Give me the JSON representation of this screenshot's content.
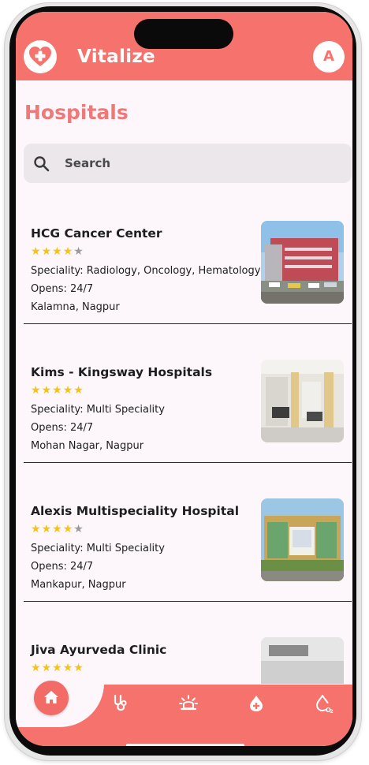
{
  "app": {
    "name": "Vitalize",
    "avatar_initial": "A",
    "brand_color": "#f5736c"
  },
  "page": {
    "title": "Hospitals"
  },
  "search": {
    "placeholder": "Search"
  },
  "hospitals": [
    {
      "name": "HCG Cancer Center",
      "rating": 4,
      "speciality": "Speciality: Radiology, Oncology, Hematology",
      "opens": "Opens: 24/7",
      "location": "Kalamna, Nagpur"
    },
    {
      "name": "Kims - Kingsway Hospitals",
      "rating": 5,
      "speciality": "Speciality: Multi Speciality",
      "opens": "Opens: 24/7",
      "location": "Mohan Nagar, Nagpur"
    },
    {
      "name": "Alexis Multispeciality Hospital",
      "rating": 4,
      "speciality": "Speciality: Multi Speciality",
      "opens": "Opens: 24/7",
      "location": "Mankapur, Nagpur"
    },
    {
      "name": "Jiva Ayurveda Clinic",
      "rating": 5,
      "speciality": "",
      "opens": "",
      "location": ""
    }
  ],
  "bottom_nav": {
    "active": "home",
    "items": [
      {
        "id": "home",
        "icon": "home-icon"
      },
      {
        "id": "doctors",
        "icon": "stethoscope-icon"
      },
      {
        "id": "emergency",
        "icon": "siren-icon"
      },
      {
        "id": "blood",
        "icon": "blood-drop-icon"
      },
      {
        "id": "oxygen",
        "icon": "oxygen-icon"
      }
    ]
  }
}
